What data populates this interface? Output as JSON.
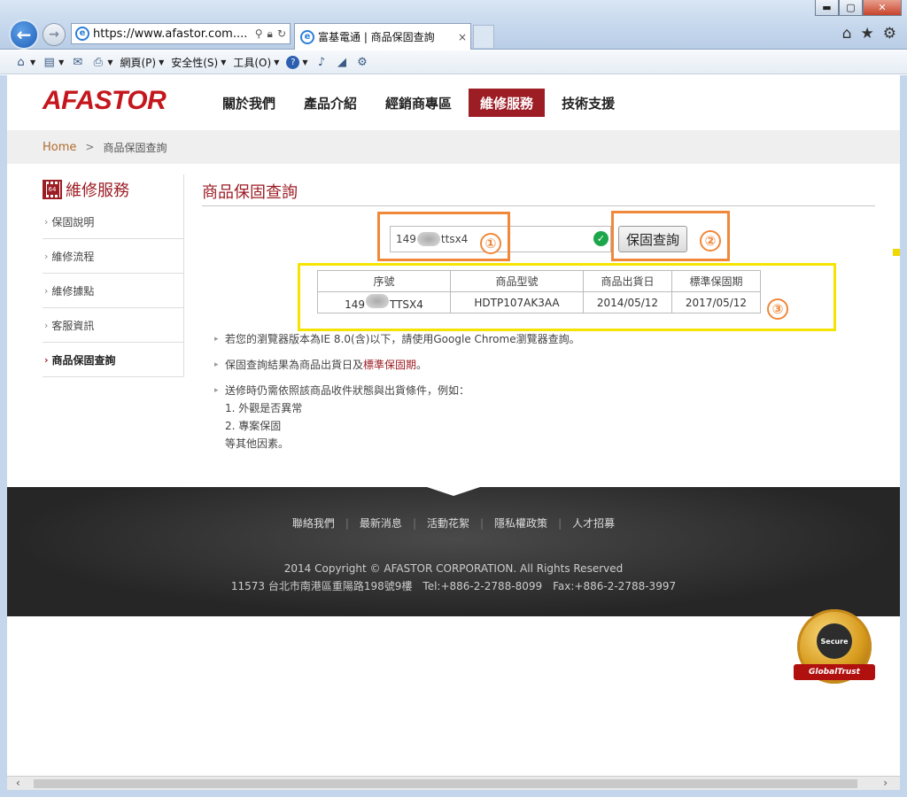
{
  "browser": {
    "url": "https://www.afastor.com....",
    "tab_title": "富基電通 | 商品保固查詢",
    "tab_close": "×",
    "window_buttons": {
      "minimize": "▬",
      "maximize": "▢",
      "close": "✕"
    },
    "command_bar": {
      "page_menu": "網頁(P)",
      "safety_menu": "安全性(S)",
      "tools_menu": "工具(O)"
    },
    "right_icons": {
      "home": "⌂",
      "favorites": "★",
      "settings": "⚙"
    }
  },
  "site": {
    "logo": "AFASTOR",
    "nav": [
      {
        "label": "關於我們",
        "active": false
      },
      {
        "label": "產品介紹",
        "active": false
      },
      {
        "label": "經銷商專區",
        "active": false
      },
      {
        "label": "維修服務",
        "active": true
      },
      {
        "label": "技術支援",
        "active": false
      }
    ],
    "breadcrumb": {
      "home": "Home",
      "separator": ">",
      "current": "商品保固查詢"
    }
  },
  "sidebar": {
    "chip_label": "64",
    "title": "維修服務",
    "items": [
      {
        "label": "保固說明",
        "active": false
      },
      {
        "label": "維修流程",
        "active": false
      },
      {
        "label": "維修據點",
        "active": false
      },
      {
        "label": "客服資訊",
        "active": false
      },
      {
        "label": "商品保固查詢",
        "active": true
      }
    ]
  },
  "content": {
    "title": "商品保固查詢",
    "serial_input": {
      "prefix": "149",
      "suffix": "ttsx4"
    },
    "query_button": "保固查詢",
    "annotations": [
      "①",
      "②",
      "③"
    ],
    "annotation_colors": {
      "box1": "#f0883a",
      "box2": "#f0883a",
      "box3": "#f5e400"
    },
    "table": {
      "headers": [
        "序號",
        "商品型號",
        "商品出貨日",
        "標準保固期"
      ],
      "row": {
        "serial_prefix": "149",
        "serial_suffix": "TTSX4",
        "model": "HDTP107AK3AA",
        "ship_date": "2014/05/12",
        "warranty_until": "2017/05/12"
      }
    },
    "notes": {
      "note1": "若您的瀏覽器版本為IE 8.0(含)以下，請使用Google Chrome瀏覽器查詢。",
      "note2_text": "保固查詢結果為商品出貨日及",
      "note2_highlight": "標準保固期",
      "note2_end": "。",
      "note3": "送修時仍需依照該商品收件狀態與出貨條件，例如：",
      "sub1": "1. 外觀是否異常",
      "sub2": "2. 專案保固",
      "sub3": "等其他因素。"
    }
  },
  "footer": {
    "links": [
      "聯絡我們",
      "最新消息",
      "活動花絮",
      "隱私權政策",
      "人才招募"
    ],
    "copyright": "2014 Copyright © AFASTOR CORPORATION. All Rights Reserved",
    "address": "11573 台北市南港區重陽路198號9樓　Tel:+886-2-2788-8099　Fax:+886-2-2788-3997"
  },
  "seal": {
    "inner": "Secure",
    "banner": "GlobalTrust"
  },
  "colors": {
    "brand": "#9d1d25",
    "logo": "#c4161c",
    "breadcrumb_home": "#b06b2c"
  }
}
